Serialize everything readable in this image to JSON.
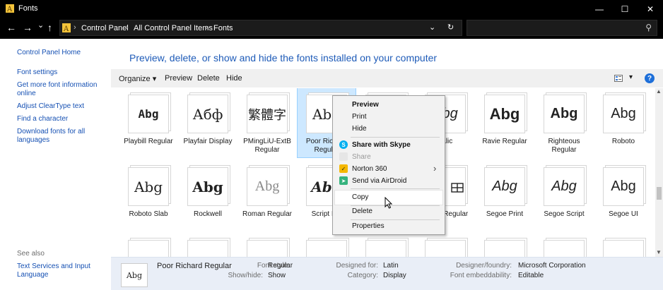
{
  "window": {
    "title": "Fonts",
    "minimize": "—",
    "maximize": "☐",
    "close": "✕"
  },
  "nav": {
    "back": "←",
    "forward": "→",
    "recent": "⌄",
    "up": "↑",
    "breadcrumbs": [
      "Control Panel",
      "All Control Panel Items",
      "Fonts"
    ],
    "dropdown": "⌄",
    "refresh": "↻",
    "search_placeholder": "",
    "search_glyph": "⚲"
  },
  "left_pane": {
    "home": "Control Panel Home",
    "links": [
      "Font settings",
      "Get more font information online",
      "Adjust ClearType text",
      "Find a character",
      "Download fonts for all languages"
    ],
    "see_also_label": "See also",
    "see_also_links": [
      "Text Services and Input Language"
    ]
  },
  "main": {
    "heading": "Preview, delete, or show and hide the fonts installed on your computer",
    "toolbar": {
      "organize": "Organize ▾",
      "preview": "Preview",
      "delete": "Delete",
      "hide": "Hide",
      "view_arrow": "▾",
      "help": "?"
    },
    "fonts_row1": [
      {
        "sample": "Abg",
        "label": "Playbill Regular"
      },
      {
        "sample": "Абф",
        "label": "Playfair Display"
      },
      {
        "sample": "繁體字",
        "label": "PMingLiU-ExtB Regular"
      },
      {
        "sample": "Abg",
        "label": "Poor Richard Regular"
      },
      {
        "sample": "",
        "label": ""
      },
      {
        "sample": "Abg",
        "label": "Italic"
      },
      {
        "sample": "Abg",
        "label": "Ravie Regular"
      },
      {
        "sample": "Abg",
        "label": "Righteous Regular"
      },
      {
        "sample": "Abg",
        "label": "Roboto"
      }
    ],
    "fonts_row2": [
      {
        "sample": "Abg",
        "label": "Roboto Slab"
      },
      {
        "sample": "Abg",
        "label": "Rockwell"
      },
      {
        "sample": "Abg",
        "label": "Roman Regular"
      },
      {
        "sample": "Abg",
        "label": "Script MT"
      },
      {
        "sample": "",
        "label": ""
      },
      {
        "sample": "",
        "label": "MDL2 Regular"
      },
      {
        "sample": "Abg",
        "label": "Segoe Print"
      },
      {
        "sample": "Abg",
        "label": "Segoe Script"
      },
      {
        "sample": "Abg",
        "label": "Segoe UI"
      }
    ]
  },
  "details": {
    "thumb_sample": "Abg",
    "name": "Poor Richard Regular",
    "font_style_key": "Font style:",
    "font_style": "Regular",
    "show_hide_key": "Show/hide:",
    "show_hide": "Show",
    "designed_for_key": "Designed for:",
    "designed_for": "Latin",
    "category_key": "Category:",
    "category": "Display",
    "designer_key": "Designer/foundry:",
    "designer": "Microsoft Corporation",
    "embeddability_key": "Font embeddability:",
    "embeddability": "Editable"
  },
  "context_menu": {
    "preview": "Preview",
    "print": "Print",
    "hide": "Hide",
    "share_skype": "Share with Skype",
    "share": "Share",
    "norton": "Norton 360",
    "airdroid": "Send via AirDroid",
    "copy": "Copy",
    "delete": "Delete",
    "properties": "Properties",
    "submenu_arrow": "›"
  },
  "colors": {
    "accent": "#1e5bb8",
    "link": "#1550b3",
    "selection": "#cde8ff",
    "skype": "#00aff0",
    "norton": "#f5b800",
    "airdroid": "#36b37e"
  }
}
